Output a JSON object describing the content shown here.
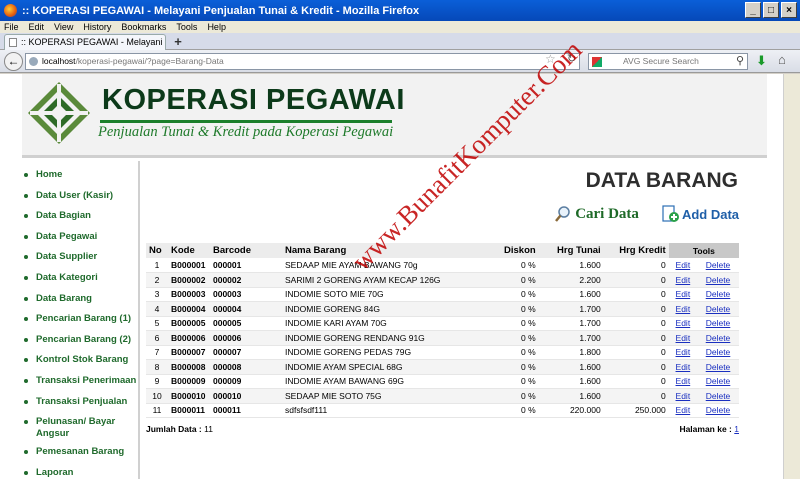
{
  "window": {
    "title": ":: KOPERASI PEGAWAI - Melayani Penjualan Tunai & Kredit - Mozilla Firefox"
  },
  "menu": [
    "File",
    "Edit",
    "View",
    "History",
    "Bookmarks",
    "Tools",
    "Help"
  ],
  "tab": {
    "label": ":: KOPERASI PEGAWAI - Melayani Penjualan ..."
  },
  "url": {
    "host": "localhost",
    "path": "/koperasi-pegawai/?page=Barang-Data"
  },
  "search": {
    "placeholder": "AVG Secure Search"
  },
  "header": {
    "brand": "KOPERASI PEGAWAI",
    "tagline": "Penjualan Tunai & Kredit pada Koperasi Pegawai"
  },
  "sidebar": [
    "Home",
    "Data User (Kasir)",
    "Data Bagian",
    "Data Pegawai",
    "Data Supplier",
    "Data Kategori",
    "Data Barang",
    "Pencarian Barang (1)",
    "Pencarian Barang (2)",
    "Kontrol Stok Barang",
    "Transaksi Penerimaan",
    "Transaksi Penjualan",
    "Pelunasan/ Bayar Angsur",
    "Pemesanan Barang",
    "Laporan"
  ],
  "page": {
    "title": "DATA BARANG",
    "search_label": "Cari Data",
    "add_label": "Add Data"
  },
  "table": {
    "headers": [
      "No",
      "Kode",
      "Barcode",
      "Nama Barang",
      "Diskon",
      "Hrg Tunai",
      "Hrg Kredit",
      "Tools"
    ],
    "rows": [
      [
        "1",
        "B000001",
        "000001",
        "SEDAAP MIE AYAM BAWANG 70g",
        "0 %",
        "1.600",
        "0"
      ],
      [
        "2",
        "B000002",
        "000002",
        "SARIMI 2 GORENG AYAM KECAP 126G",
        "0 %",
        "2.200",
        "0"
      ],
      [
        "3",
        "B000003",
        "000003",
        "INDOMIE SOTO MIE 70G",
        "0 %",
        "1.600",
        "0"
      ],
      [
        "4",
        "B000004",
        "000004",
        "INDOMIE GORENG 84G",
        "0 %",
        "1.700",
        "0"
      ],
      [
        "5",
        "B000005",
        "000005",
        "INDOMIE KARI AYAM 70G",
        "0 %",
        "1.700",
        "0"
      ],
      [
        "6",
        "B000006",
        "000006",
        "INDOMIE GORENG RENDANG 91G",
        "0 %",
        "1.700",
        "0"
      ],
      [
        "7",
        "B000007",
        "000007",
        "INDOMIE GORENG PEDAS 79G",
        "0 %",
        "1.800",
        "0"
      ],
      [
        "8",
        "B000008",
        "000008",
        "INDOMIE AYAM SPECIAL 68G",
        "0 %",
        "1.600",
        "0"
      ],
      [
        "9",
        "B000009",
        "000009",
        "INDOMIE AYAM BAWANG 69G",
        "0 %",
        "1.600",
        "0"
      ],
      [
        "10",
        "B000010",
        "000010",
        "SEDAAP MIE SOTO 75G",
        "0 %",
        "1.600",
        "0"
      ],
      [
        "11",
        "B000011",
        "000011",
        "sdfsfsdf111",
        "0 %",
        "220.000",
        "250.000"
      ]
    ],
    "edit_label": "Edit",
    "delete_label": "Delete"
  },
  "summary": {
    "label": "Jumlah Data :",
    "count": "11"
  },
  "paging": {
    "label": "Halaman ke :",
    "current": "1"
  },
  "watermark": "www.BunafitKomputer.Com",
  "colors": {
    "brand_green": "#1f6a2c",
    "link_blue": "#1a2fc0",
    "title_blue": "#0648b8"
  }
}
